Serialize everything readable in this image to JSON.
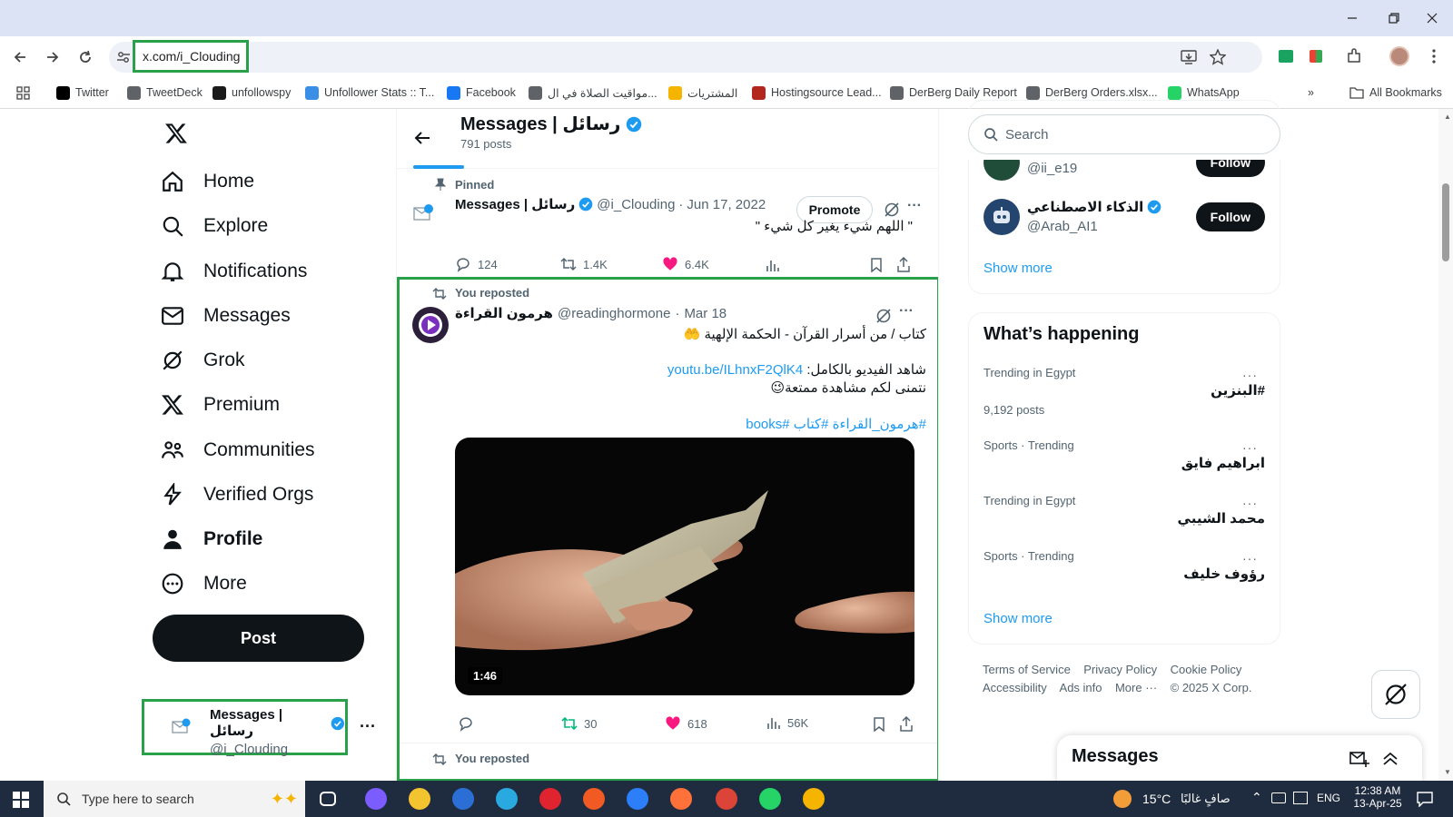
{
  "browser": {
    "url": "x.com/i_Clouding",
    "bookmarks": [
      {
        "label": "Twitter",
        "color": "#000000"
      },
      {
        "label": "TweetDeck",
        "color": "#5f6368"
      },
      {
        "label": "unfollowspy",
        "color": "#1a1a1a"
      },
      {
        "label": "Unfollower Stats :: T...",
        "color": "#3a8ee6"
      },
      {
        "label": "Facebook",
        "color": "#1877f2"
      },
      {
        "label": "مواقيت الصلاة في ال...",
        "color": "#5f6368"
      },
      {
        "label": "المشتريات",
        "color": "#f4b400"
      },
      {
        "label": "Hostingsource Lead...",
        "color": "#b3261e"
      },
      {
        "label": "DerBerg Daily Report",
        "color": "#5f6368"
      },
      {
        "label": "DerBerg Orders.xlsx...",
        "color": "#5f6368"
      },
      {
        "label": "WhatsApp",
        "color": "#25d366"
      }
    ],
    "all_bookmarks": "All Bookmarks"
  },
  "sidebar": {
    "items": [
      {
        "label": "Home",
        "icon": "home-icon"
      },
      {
        "label": "Explore",
        "icon": "search-icon"
      },
      {
        "label": "Notifications",
        "icon": "bell-icon"
      },
      {
        "label": "Messages",
        "icon": "mail-icon"
      },
      {
        "label": "Grok",
        "icon": "grok-icon"
      },
      {
        "label": "Premium",
        "icon": "x-logo-icon"
      },
      {
        "label": "Communities",
        "icon": "people-icon"
      },
      {
        "label": "Verified Orgs",
        "icon": "lightning-icon"
      },
      {
        "label": "Profile",
        "icon": "person-icon"
      },
      {
        "label": "More",
        "icon": "more-circle-icon"
      }
    ],
    "post_label": "Post",
    "account": {
      "name": "Messages | رسائل",
      "handle": "@i_Clouding"
    }
  },
  "profile_header": {
    "name": "Messages | رسائل",
    "posts": "791 posts"
  },
  "pinned": {
    "label": "Pinned",
    "name": "Messages | رسائل",
    "handle": "@i_Clouding",
    "date": "Jun 17, 2022",
    "promote": "Promote",
    "text": "\" اللهم شيء يغير كل شيء \"",
    "replies": "124",
    "reposts": "1.4K",
    "likes": "6.4K"
  },
  "repost": {
    "label": "You reposted",
    "name": "هرمون القراءة",
    "handle": "@readinghormone",
    "date": "Mar 18",
    "line1": "كتاب / من أسرار القرآن - الحكمة الإلهية 🤲",
    "line2_prefix": "شاهد الفيديو بالكامل:",
    "link": "youtu.be/ILhnxF2QlK4",
    "line3": "نتمنى لكم مشاهدة ممتعة😉",
    "hashtags": "#هرمون_القراءة #كتاب #books",
    "video_duration": "1:46",
    "replies": "",
    "reposts": "30",
    "likes": "618",
    "views": "56K"
  },
  "next_repost_label": "You reposted",
  "right": {
    "search_placeholder": "Search",
    "follow_suggestions": [
      {
        "handle": "@ii_e19",
        "follow_label": "Follow"
      },
      {
        "name": "الذكاء الاصطناعي",
        "handle": "@Arab_AI1",
        "follow_label": "Follow"
      }
    ],
    "show_more": "Show more",
    "whats_happening": "What’s happening",
    "trends": [
      {
        "meta": "Trending in Egypt",
        "name": "#البنزين",
        "posts": "9,192 posts"
      },
      {
        "meta": "Sports · Trending",
        "name": "ابراهيم فايق",
        "posts": ""
      },
      {
        "meta": "Trending in Egypt",
        "name": "محمد الشيبي",
        "posts": ""
      },
      {
        "meta": "Sports · Trending",
        "name": "رؤوف خليف",
        "posts": ""
      }
    ],
    "show_more_2": "Show more",
    "footer": {
      "terms": "Terms of Service",
      "privacy": "Privacy Policy",
      "cookie": "Cookie Policy",
      "accessibility": "Accessibility",
      "ads": "Ads info",
      "more": "More ···",
      "copyright": "© 2025 X Corp."
    }
  },
  "messages_dock": {
    "title": "Messages"
  },
  "taskbar": {
    "search_placeholder": "Type here to search",
    "weather": "15°C",
    "weather_desc": "صافٍ غالبًا",
    "lang": "ENG",
    "time": "12:38 AM",
    "date": "13-Apr-25"
  }
}
